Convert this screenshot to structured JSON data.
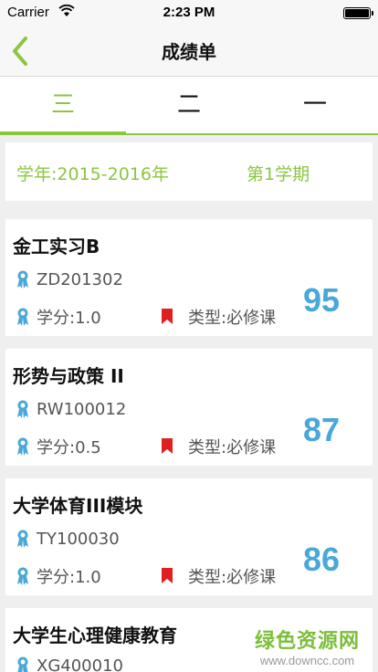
{
  "status_bar": {
    "carrier": "Carrier",
    "time": "2:23 PM"
  },
  "nav": {
    "title": "成绩单"
  },
  "tabs": [
    {
      "label": "三",
      "active": true
    },
    {
      "label": "二",
      "active": false
    },
    {
      "label": "一",
      "active": false
    }
  ],
  "term": {
    "year": "学年:2015-2016年",
    "semester": "第1学期"
  },
  "courses": [
    {
      "name": "金工实习B",
      "code": "ZD201302",
      "credit": "学分:1.0",
      "type": "类型:必修课",
      "score": "95"
    },
    {
      "name": "形势与政策 II",
      "code": "RW100012",
      "credit": "学分:0.5",
      "type": "类型:必修课",
      "score": "87"
    },
    {
      "name": "大学体育III模块",
      "code": "TY100030",
      "credit": "学分:1.0",
      "type": "类型:必修课",
      "score": "86"
    },
    {
      "name": "大学生心理健康教育",
      "code": "XG400010"
    }
  ],
  "watermark": {
    "text": "绿色资源网",
    "url": "www.downcc.com"
  },
  "colors": {
    "accent": "#8cc63f",
    "score": "#4aa8d8",
    "icon": "#4aa8d8",
    "bookmark": "#e02020"
  },
  "icons": {
    "back": "chevron-left-icon",
    "award": "award-ribbon-icon",
    "type": "bookmark-icon"
  }
}
